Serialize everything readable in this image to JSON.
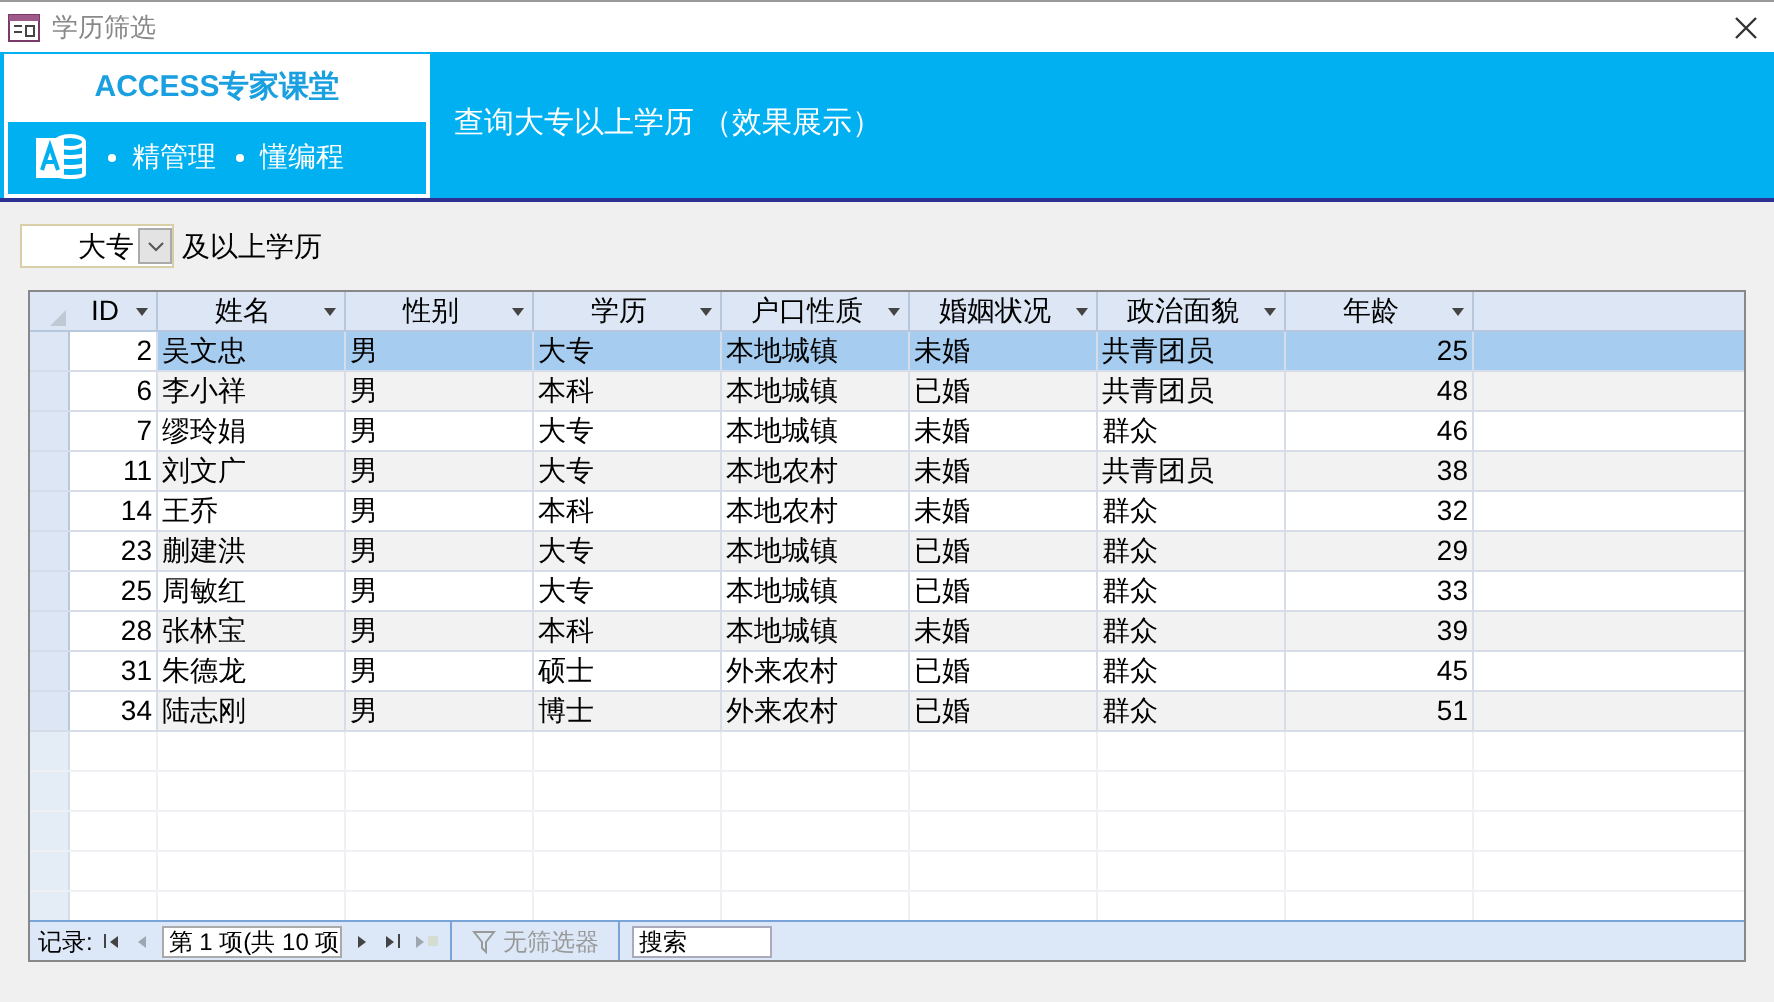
{
  "window": {
    "title": "学历筛选"
  },
  "banner": {
    "logo_title": "ACCESS专家课堂",
    "logo_items": [
      "精管理",
      "懂编程"
    ],
    "heading": "查询大专以上学历 （效果展示）"
  },
  "filter": {
    "value": "大专",
    "label": "及以上学历"
  },
  "table": {
    "columns": [
      "ID",
      "姓名",
      "性别",
      "学历",
      "户口性质",
      "婚姻状况",
      "政治面貌",
      "年龄"
    ],
    "rows": [
      {
        "cells": [
          "2",
          "吴文忠",
          "男",
          "大专",
          "本地城镇",
          "未婚",
          "共青团员",
          "25"
        ],
        "selected": true
      },
      {
        "cells": [
          "6",
          "李小祥",
          "男",
          "本科",
          "本地城镇",
          "已婚",
          "共青团员",
          "48"
        ],
        "selected": false
      },
      {
        "cells": [
          "7",
          "缪玲娟",
          "男",
          "大专",
          "本地城镇",
          "未婚",
          "群众",
          "46"
        ],
        "selected": false
      },
      {
        "cells": [
          "11",
          "刘文广",
          "男",
          "大专",
          "本地农村",
          "未婚",
          "共青团员",
          "38"
        ],
        "selected": false
      },
      {
        "cells": [
          "14",
          "王乔",
          "男",
          "本科",
          "本地农村",
          "未婚",
          "群众",
          "32"
        ],
        "selected": false
      },
      {
        "cells": [
          "23",
          "蒯建洪",
          "男",
          "大专",
          "本地城镇",
          "已婚",
          "群众",
          "29"
        ],
        "selected": false
      },
      {
        "cells": [
          "25",
          "周敏红",
          "男",
          "大专",
          "本地城镇",
          "已婚",
          "群众",
          "33"
        ],
        "selected": false
      },
      {
        "cells": [
          "28",
          "张林宝",
          "男",
          "本科",
          "本地城镇",
          "未婚",
          "群众",
          "39"
        ],
        "selected": false
      },
      {
        "cells": [
          "31",
          "朱德龙",
          "男",
          "硕士",
          "外来农村",
          "已婚",
          "群众",
          "45"
        ],
        "selected": false
      },
      {
        "cells": [
          "34",
          "陆志刚",
          "男",
          "博士",
          "外来农村",
          "已婚",
          "群众",
          "51"
        ],
        "selected": false
      }
    ]
  },
  "navigation": {
    "label": "记录:",
    "position": "第 1 项(共 10 项",
    "filter": "无筛选器",
    "search": {
      "placeholder": "搜索"
    }
  }
}
